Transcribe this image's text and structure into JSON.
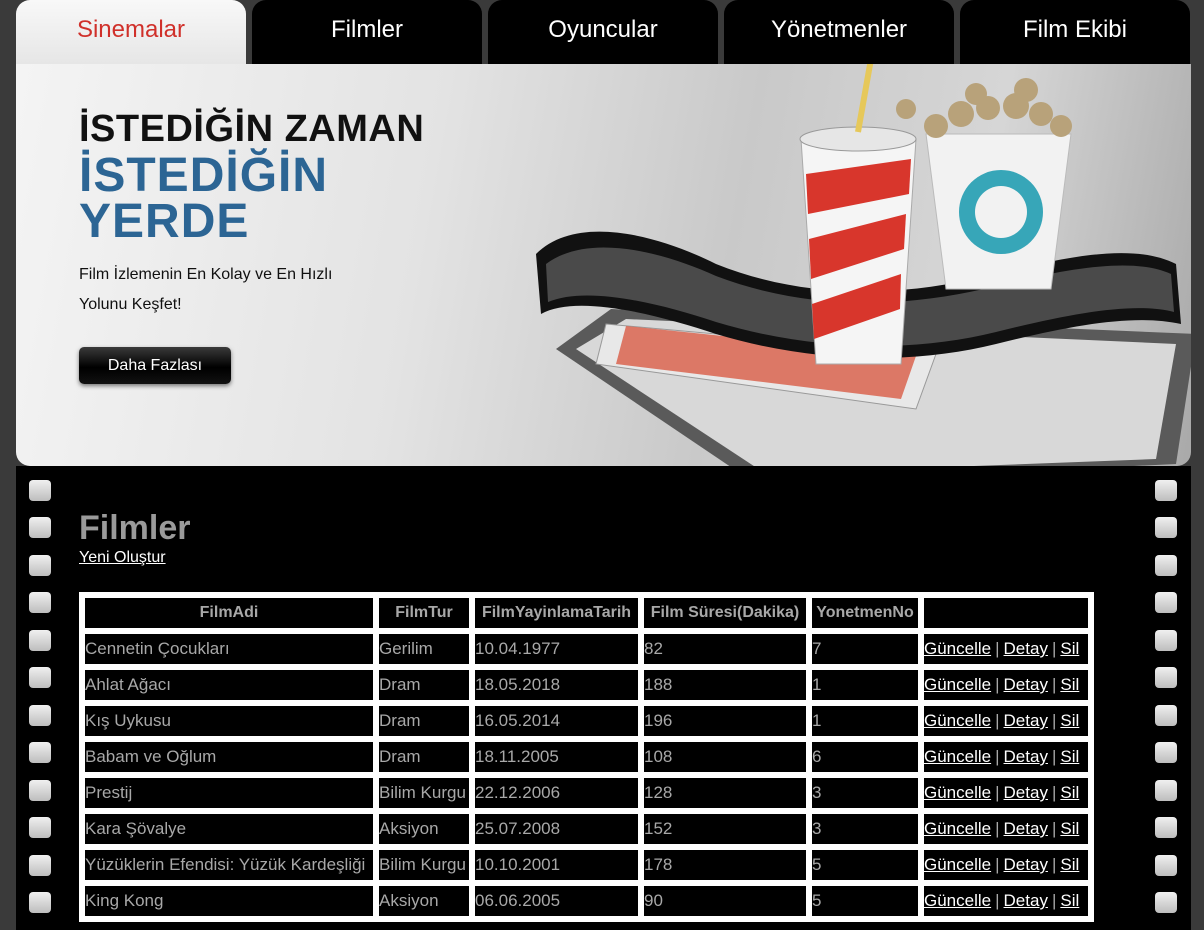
{
  "nav": {
    "tabs": [
      {
        "label": "Sinemalar",
        "active": true
      },
      {
        "label": "Filmler"
      },
      {
        "label": "Oyuncular"
      },
      {
        "label": "Yönetmenler"
      },
      {
        "label": "Film Ekibi"
      }
    ]
  },
  "hero": {
    "line1": "İSTEDİĞİN ZAMAN",
    "line2": "İSTEDİĞİN",
    "line3": "YERDE",
    "subtitle": "Film İzlemenin En Kolay ve En Hızlı Yolunu Keşfet!",
    "button": "Daha Fazlası",
    "image": "cinema-popcorn-drink-filmstrip"
  },
  "main": {
    "title": "Filmler",
    "create_link": "Yeni Oluştur",
    "columns": [
      "FilmAdi",
      "FilmTur",
      "FilmYayinlamaTarih",
      "Film Süresi(Dakika)",
      "YonetmenNo",
      ""
    ],
    "rows": [
      [
        "Cennetin Çocukları",
        "Gerilim",
        "10.04.1977",
        "82",
        "7"
      ],
      [
        "Ahlat Ağacı",
        "Dram",
        "18.05.2018",
        "188",
        "1"
      ],
      [
        "Kış Uykusu",
        "Dram",
        "16.05.2014",
        "196",
        "1"
      ],
      [
        "Babam ve Oğlum",
        "Dram",
        "18.11.2005",
        "108",
        "6"
      ],
      [
        "Prestij",
        "Bilim Kurgu",
        "22.12.2006",
        "128",
        "3"
      ],
      [
        "Kara Şövalye",
        "Aksiyon",
        "25.07.2008",
        "152",
        "3"
      ],
      [
        "Yüzüklerin Efendisi: Yüzük Kardeşliği",
        "Bilim Kurgu",
        "10.10.2001",
        "178",
        "5"
      ],
      [
        "King Kong",
        "Aksiyon",
        "06.06.2005",
        "90",
        "5"
      ]
    ],
    "actions": {
      "edit": "Güncelle",
      "detail": "Detay",
      "delete": "Sil",
      "separator": "|"
    }
  },
  "colors": {
    "accent": "#d0302a",
    "brand_blue": "#2c6594",
    "strip": "#000000"
  }
}
